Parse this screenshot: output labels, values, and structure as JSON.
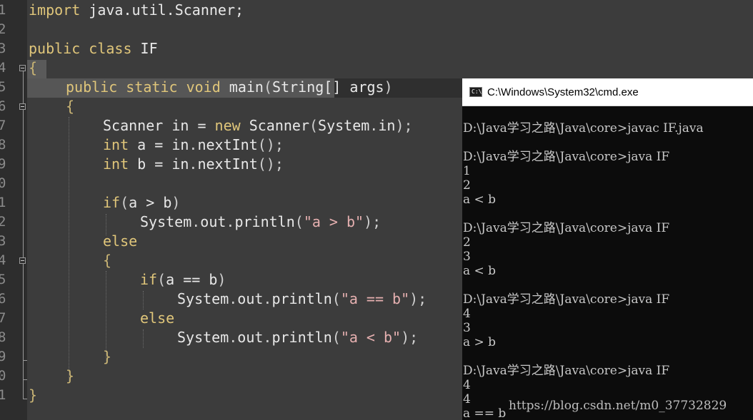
{
  "editor": {
    "line_numbers": [
      "1",
      "2",
      "3",
      "4",
      "5",
      "6",
      "7",
      "8",
      "9",
      "0",
      "1",
      "2",
      "3",
      "4",
      "5",
      "6",
      "7",
      "8",
      "9",
      "0",
      "1"
    ],
    "code": {
      "l1": {
        "kw": "import",
        "rest": " java.util.Scanner;"
      },
      "l3": {
        "kw1": "public",
        "kw2": "class",
        "name": " IF"
      },
      "l4": {
        "brace": "{"
      },
      "l5": {
        "kw1": "public",
        "kw2": "static",
        "kw3": "void",
        "name": " main",
        "open": "(",
        "arg": "String[] args",
        "close": ")"
      },
      "l6": {
        "brace": "{"
      },
      "l7": {
        "a": "Scanner in ",
        "eq": "=",
        "kw": " new",
        "b": " Scanner",
        "open": "(",
        "c": "System",
        "dot": ".",
        "d": "in",
        "close": ");"
      },
      "l8": {
        "kw": "int",
        "a": " a ",
        "eq": "=",
        "b": " in",
        "dot": ".",
        "c": "nextInt",
        "close": "();"
      },
      "l9": {
        "kw": "int",
        "a": " b ",
        "eq": "=",
        "b": " in",
        "dot": ".",
        "c": "nextInt",
        "close": "();"
      },
      "l11": {
        "kw": "if",
        "open": "(",
        "a": "a ",
        "op": ">",
        "b": " b",
        "close": ")"
      },
      "l12": {
        "a": "System",
        "dot1": ".",
        "b": "out",
        "dot2": ".",
        "c": "println",
        "open": "(",
        "str": "\"a > b\"",
        "close": ");"
      },
      "l13": {
        "kw": "else"
      },
      "l14": {
        "brace": "{"
      },
      "l15": {
        "kw": "if",
        "open": "(",
        "a": "a ",
        "op": "==",
        "b": " b",
        "close": ")"
      },
      "l16": {
        "a": "System",
        "dot1": ".",
        "b": "out",
        "dot2": ".",
        "c": "println",
        "open": "(",
        "str": "\"a == b\"",
        "close": ");"
      },
      "l17": {
        "kw": "else"
      },
      "l18": {
        "a": "System",
        "dot1": ".",
        "b": "out",
        "dot2": ".",
        "c": "println",
        "open": "(",
        "str": "\"a < b\"",
        "close": ");"
      },
      "l19": {
        "brace": "}"
      },
      "l20": {
        "brace": "}"
      },
      "l21": {
        "brace": "}"
      }
    }
  },
  "cmd": {
    "title": "C:\\Windows\\System32\\cmd.exe",
    "icon_label": "C:\\",
    "lines": [
      "D:\\Java学习之路\\Java\\core>javac IF.java",
      "D:\\Java学习之路\\Java\\core>java IF",
      "1",
      "2",
      "a < b",
      "D:\\Java学习之路\\Java\\core>java IF",
      "2",
      "3",
      "a < b",
      "D:\\Java学习之路\\Java\\core>java IF",
      "4",
      "3",
      "a > b",
      "D:\\Java学习之路\\Java\\core>java IF",
      "4",
      "4",
      "a == b"
    ]
  },
  "watermark": "https://blog.csdn.net/m0_37732829",
  "colors": {
    "editor_bg": "#3c3c3c",
    "gutter_bg": "#2d2d2d",
    "keyword": "#e0c67a",
    "string": "#e6b0b0",
    "cmd_bg": "#0c0c0c",
    "cmd_text": "#c8c8c8"
  }
}
